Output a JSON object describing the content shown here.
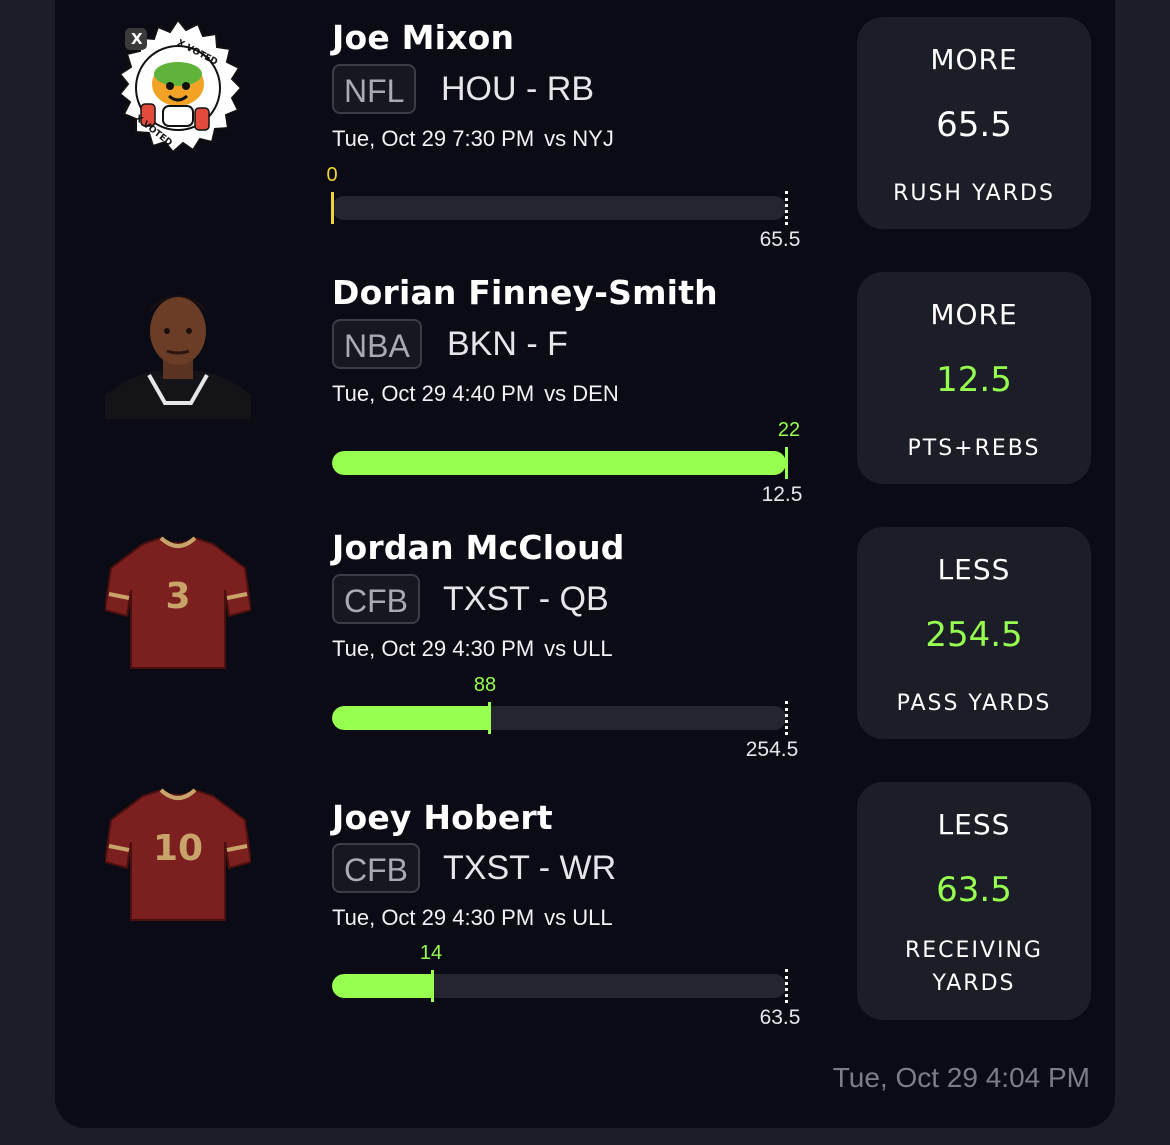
{
  "entries": [
    {
      "name": "Joe Mixon",
      "league": "NFL",
      "team_pos": "HOU - RB",
      "date": "Tue, Oct 29 7:30 PM",
      "opponent": "vs NYJ",
      "current": "0",
      "current_value": 0,
      "line": "65.5",
      "line_value": 65.5,
      "pick": {
        "direction": "MORE",
        "value": "65.5",
        "stat": "RUSH YARDS",
        "stat_line2": ""
      },
      "avatar": "x-voted-badge-icon",
      "badge_text": {
        "top": "X VOTED",
        "bottom": "X VOTED",
        "logo": "X"
      }
    },
    {
      "name": "Dorian Finney-Smith",
      "league": "NBA",
      "team_pos": "BKN - F",
      "date": "Tue, Oct 29 4:40 PM",
      "opponent": "vs DEN",
      "current": "22",
      "current_value": 22,
      "line": "12.5",
      "line_value": 12.5,
      "pick": {
        "direction": "MORE",
        "value": "12.5",
        "stat": "PTS+REBS",
        "stat_line2": ""
      },
      "avatar": "player-photo-icon"
    },
    {
      "name": "Jordan McCloud",
      "league": "CFB",
      "team_pos": "TXST - QB",
      "date": "Tue, Oct 29 4:30 PM",
      "opponent": "vs ULL",
      "current": "88",
      "current_value": 88,
      "line": "254.5",
      "line_value": 254.5,
      "pick": {
        "direction": "LESS",
        "value": "254.5",
        "stat": "PASS YARDS",
        "stat_line2": ""
      },
      "avatar": "jersey-icon",
      "jersey_number": "3"
    },
    {
      "name": "Joey Hobert",
      "league": "CFB",
      "team_pos": "TXST - WR",
      "date": "Tue, Oct 29 4:30 PM",
      "opponent": "vs ULL",
      "current": "14",
      "current_value": 14,
      "line": "63.5",
      "line_value": 63.5,
      "pick": {
        "direction": "LESS",
        "value": "63.5",
        "stat": "RECEIVING",
        "stat_line2": "YARDS"
      },
      "avatar": "jersey-icon",
      "jersey_number": "10"
    }
  ],
  "timestamp": "Tue, Oct 29 4:04 PM",
  "colors": {
    "accent_green": "#96ff50",
    "zero_yellow": "#f3d23a",
    "card_bg": "#0a0b14",
    "pick_bg": "#1b1d27",
    "jersey": "#7c1f1f",
    "jersey_trim": "#c8a46a"
  }
}
